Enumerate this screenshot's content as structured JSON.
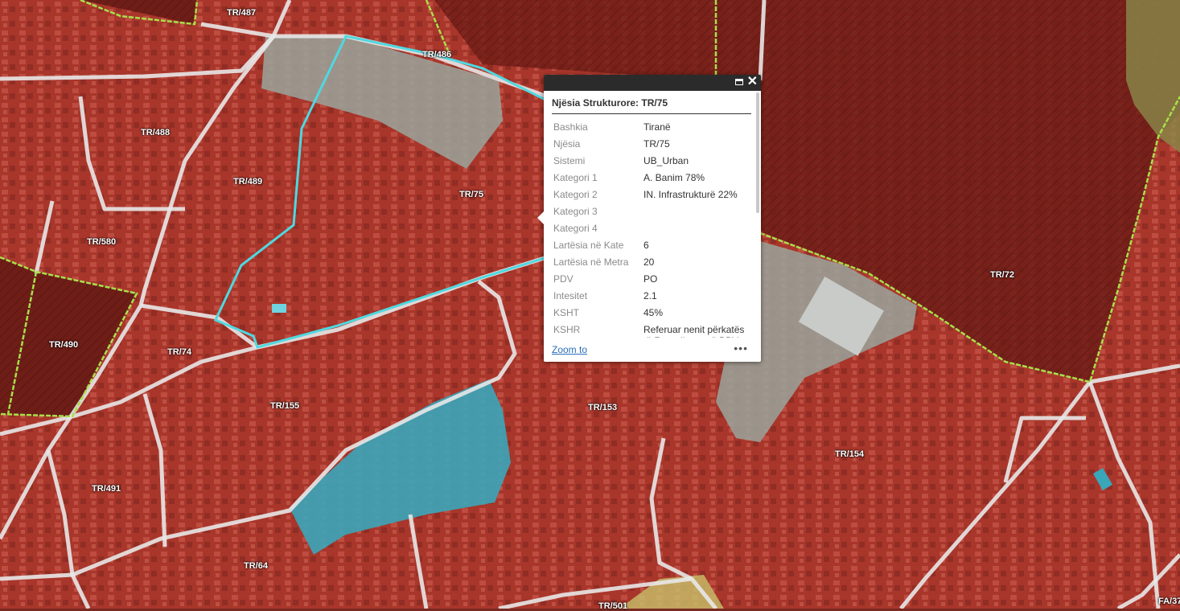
{
  "map": {
    "labels": [
      "TR/487",
      "TR/486",
      "TR/488",
      "TR/489",
      "TR/75",
      "TR/580",
      "TR/490",
      "TR/74",
      "TR/155",
      "TR/153",
      "TR/72",
      "TR/154",
      "TR/491",
      "TR/64",
      "TR/501",
      "FA/37"
    ]
  },
  "popup": {
    "title": "Njësia Strukturore: TR/75",
    "rows": [
      {
        "key": "Bashkia",
        "value": "Tiranë"
      },
      {
        "key": "Njësia",
        "value": "TR/75"
      },
      {
        "key": "Sistemi",
        "value": "UB_Urban"
      },
      {
        "key": "Kategori 1",
        "value": "A. Banim 78%"
      },
      {
        "key": "Kategori 2",
        "value": "IN. Infrastrukturë 22%"
      },
      {
        "key": "Kategori 3",
        "value": ""
      },
      {
        "key": "Kategori 4",
        "value": ""
      },
      {
        "key": "Lartësia në Kate",
        "value": "6"
      },
      {
        "key": "Lartësia në Metra",
        "value": "20"
      },
      {
        "key": "PDV",
        "value": "PO"
      },
      {
        "key": "Intesitet",
        "value": "2.1"
      },
      {
        "key": "KSHT",
        "value": "45%"
      },
      {
        "key": "KSHR",
        "value": "Referuar nenit përkatës të Rregullores së PPV"
      }
    ],
    "zoom_label": "Zoom to",
    "more_label": "•••"
  },
  "colors": {
    "urban_fill": "#c0392b",
    "highlight": "#4fd8e0",
    "boundary_green": "#a8e04a",
    "road": "#e8e8e8",
    "water_fill": "#3aa6b9",
    "grey_zone": "#9aa59c"
  }
}
